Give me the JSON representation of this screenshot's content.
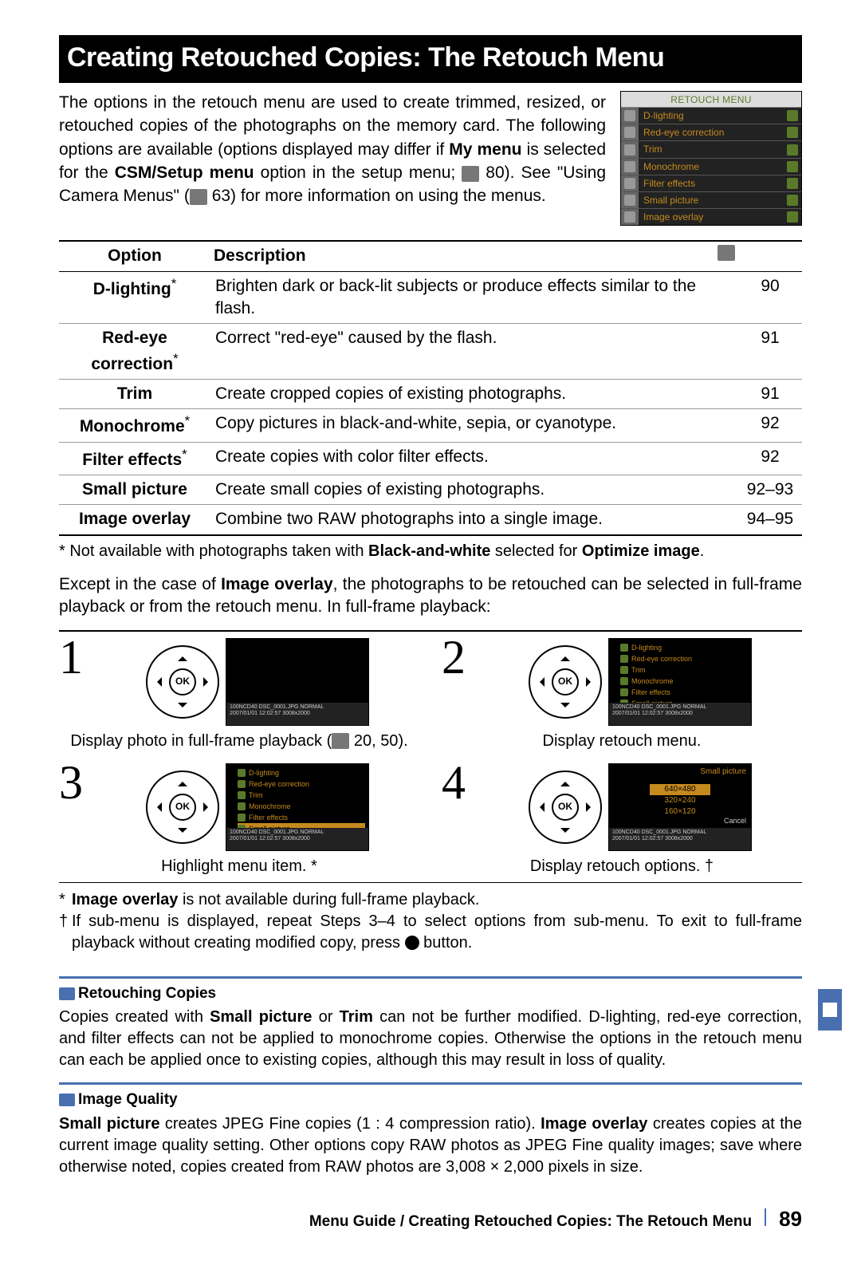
{
  "title": "Creating Retouched Copies: The Retouch Menu",
  "intro": {
    "p1a": "The options in the retouch menu are used to create trimmed, resized, or retouched copies of the photographs on the memory card.  The following options are available (options displayed may differ if ",
    "b1": "My menu",
    "p1b": " is selected for the ",
    "b2": "CSM/Setup menu",
    "p1c": " option in the setup menu; ",
    "ref1": "80",
    "p1d": ").  See \"Using Camera Menus\" (",
    "ref2": "63",
    "p1e": ") for more information on using the menus."
  },
  "menu_shot": {
    "title": "RETOUCH MENU",
    "items": [
      "D-lighting",
      "Red-eye correction",
      "Trim",
      "Monochrome",
      "Filter effects",
      "Small picture",
      "Image overlay"
    ]
  },
  "table": {
    "h_option": "Option",
    "h_desc": "Description",
    "rows": [
      {
        "opt": "D-lighting",
        "ast": "*",
        "desc": "Brighten dark or back-lit subjects or produce effects similar to the flash.",
        "pg": "90"
      },
      {
        "opt": "Red-eye correction",
        "ast": "*",
        "desc": "Correct \"red-eye\" caused by the flash.",
        "pg": "91"
      },
      {
        "opt": "Trim",
        "ast": "",
        "desc": "Create cropped copies of existing photographs.",
        "pg": "91"
      },
      {
        "opt": "Monochrome",
        "ast": "*",
        "desc": "Copy pictures in black-and-white, sepia, or cyanotype.",
        "pg": "92"
      },
      {
        "opt": "Filter effects",
        "ast": "*",
        "desc": "Create copies with color filter effects.",
        "pg": "92"
      },
      {
        "opt": "Small picture",
        "ast": "",
        "desc": "Create small copies of existing photographs.",
        "pg": "92–93"
      },
      {
        "opt": "Image overlay",
        "ast": "",
        "desc": "Combine two RAW photographs into a single image.",
        "pg": "94–95"
      }
    ]
  },
  "table_footnote": {
    "a": "* Not available with photographs taken with ",
    "b": "Black-and-white",
    "c": " selected for ",
    "d": "Optimize image",
    "e": "."
  },
  "para2": {
    "a": "Except in the case of ",
    "b": "Image overlay",
    "c": ", the photographs to be retouched can be selected in full-frame playback or from the retouch menu.  In full-frame playback:"
  },
  "steps": {
    "s1": {
      "num": "1",
      "cap_a": "Display photo in full-frame playback (",
      "ref": "20, 50",
      "cap_b": ")."
    },
    "s2": {
      "num": "2",
      "cap": "Display retouch menu."
    },
    "s3": {
      "num": "3",
      "cap": "Highlight menu item. *"
    },
    "s4": {
      "num": "4",
      "cap": "Display retouch options. †"
    }
  },
  "lcd_menu": {
    "items": [
      "D-lighting",
      "Red-eye correction",
      "Trim",
      "Monochrome",
      "Filter effects",
      "Small picture"
    ],
    "cancel": "Cancel",
    "bar_l1": "100NCD40     DSC_0001.JPG          NORMAL",
    "bar_l2": "2007/01/01 12:02:57           3008x2000"
  },
  "lcd_small": {
    "title": "Small picture",
    "opts": [
      "640×480",
      "320×240",
      "160×120"
    ],
    "cancel": "Cancel"
  },
  "notes": {
    "n1_a": "Image overlay",
    "n1_b": " is not available during full-frame playback.",
    "n2": "If sub-menu is displayed, repeat Steps 3–4 to select options from sub-menu.  To exit to full-frame playback without creating modified copy, press ",
    "n2b": " button."
  },
  "tip1": {
    "title": "Retouching Copies",
    "body_a": "Copies created with ",
    "body_b": "Small picture",
    "body_c": " or ",
    "body_d": "Trim",
    "body_e": " can not be further modified.  D-lighting, red-eye correction, and filter effects can not be applied to monochrome copies.  Otherwise the options in the retouch menu can each be applied once to existing copies, although this may result in loss of quality."
  },
  "tip2": {
    "title": "Image Quality",
    "body_a": "Small picture",
    "body_b": " creates JPEG Fine copies (1 : 4 compression ratio).  ",
    "body_c": "Image overlay",
    "body_d": " creates copies at the current image quality setting.  Other options copy RAW photos as JPEG Fine quality images; save where otherwise noted, copies created from RAW photos are 3,008 × 2,000 pixels in size."
  },
  "footer": {
    "crumb": "Menu Guide / Creating Retouched Copies: The Retouch Menu",
    "page": "89"
  }
}
